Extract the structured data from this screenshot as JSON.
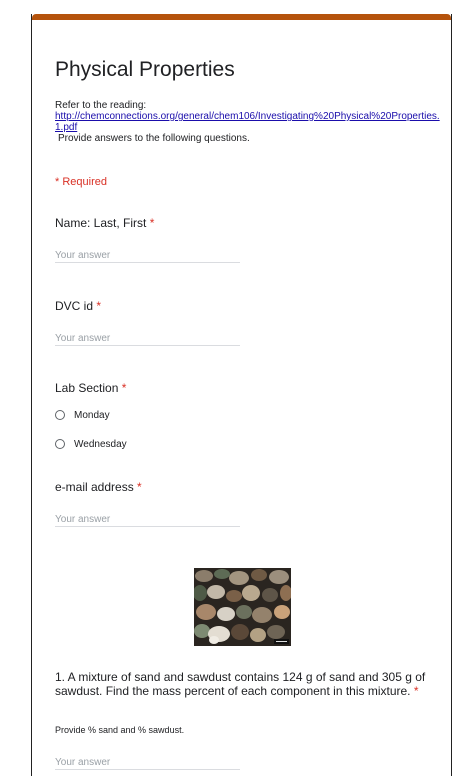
{
  "form": {
    "title": "Physical Properties",
    "description_intro": "Refer to the reading:",
    "description_link": "http://chemconnections.org/general/chem106/Investigating%20Physical%20Properties.1.pdf",
    "description_outro": "Provide answers to the following questions.",
    "required_note": "* Required",
    "accent_color": "#b5530c"
  },
  "questions": {
    "name": {
      "label": "Name: Last, First",
      "required_mark": "*",
      "placeholder": "Your answer"
    },
    "dvc_id": {
      "label": "DVC id",
      "required_mark": "*",
      "placeholder": "Your answer"
    },
    "lab_section": {
      "label": "Lab Section",
      "required_mark": "*",
      "options": [
        "Monday",
        "Wednesday"
      ]
    },
    "email": {
      "label": "e-mail address",
      "required_mark": "*",
      "placeholder": "Your answer"
    },
    "q1": {
      "text": "1. A mixture of sand and sawdust contains 124 g of sand and 305 g of sawdust. Find the mass percent of each component in this mixture.",
      "required_mark": "*",
      "help": "Provide % sand and % sawdust.",
      "placeholder": "Your answer"
    }
  }
}
